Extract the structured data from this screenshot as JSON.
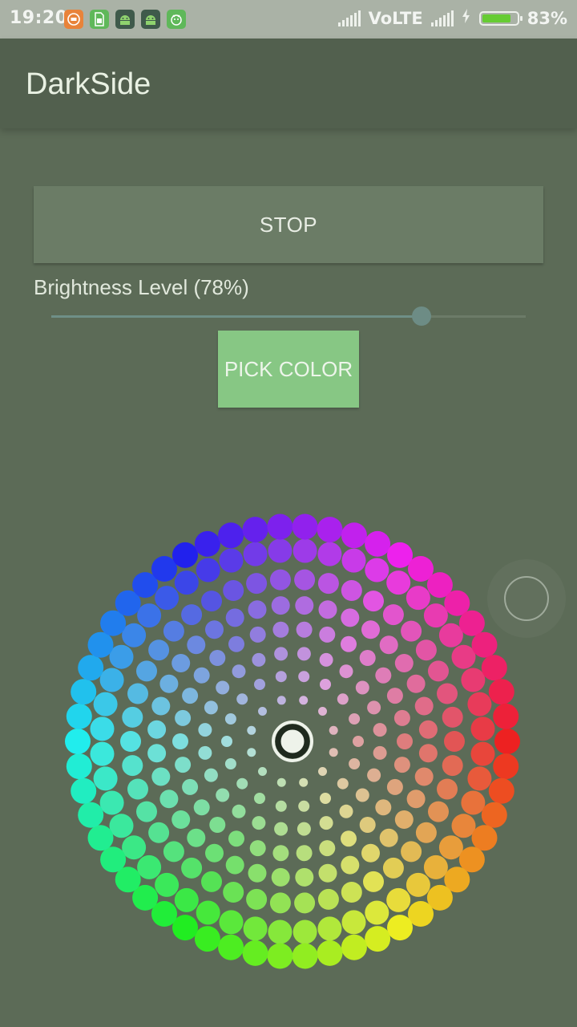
{
  "status_bar": {
    "time": "19:20",
    "network": "VoLTE",
    "battery_percent": "83%",
    "battery_level": 0.83,
    "notification_icons": [
      "mi-icon",
      "sim-icon",
      "android-icon",
      "android-icon",
      "robot-icon"
    ]
  },
  "app_bar": {
    "title": "DarkSide"
  },
  "controls": {
    "stop_label": "STOP",
    "brightness_label": "Brightness Level (78%)",
    "brightness_value": 0.78,
    "pick_color_label": "PICK COLOR"
  },
  "color_wheel": {
    "selected_swatch": "center",
    "colors": {
      "background": "#5c6b57",
      "accent_green": "#87c784",
      "slider_accent": "#6d8c85"
    }
  }
}
